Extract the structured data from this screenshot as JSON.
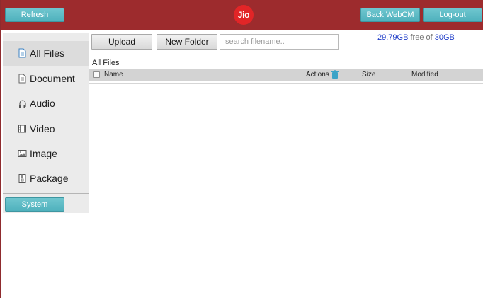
{
  "header": {
    "refresh_label": "Refresh",
    "logo_text": "Jio",
    "back_label": "Back WebCM",
    "logout_label": "Log-out"
  },
  "colors": {
    "header_bg": "#9d2b2d",
    "button_accent": "#5bbac5",
    "logo_red": "#e22527",
    "storage_blue": "#1e3cc8"
  },
  "sidebar": {
    "items": [
      {
        "label": "All Files",
        "icon": "file-icon",
        "active": true
      },
      {
        "label": "Document",
        "icon": "document-icon",
        "active": false
      },
      {
        "label": "Audio",
        "icon": "audio-icon",
        "active": false
      },
      {
        "label": "Video",
        "icon": "video-icon",
        "active": false
      },
      {
        "label": "Image",
        "icon": "image-icon",
        "active": false
      },
      {
        "label": "Package",
        "icon": "package-icon",
        "active": false
      }
    ],
    "system_label": "System"
  },
  "toolbar": {
    "upload_label": "Upload",
    "new_folder_label": "New Folder",
    "search_placeholder": "search filename.."
  },
  "storage": {
    "free": "29.79GB",
    "middle": "free of",
    "total": "30GB"
  },
  "breadcrumb": "All Files",
  "table": {
    "columns": {
      "name": "Name",
      "actions": "Actions",
      "size": "Size",
      "modified": "Modified"
    },
    "rows": []
  }
}
